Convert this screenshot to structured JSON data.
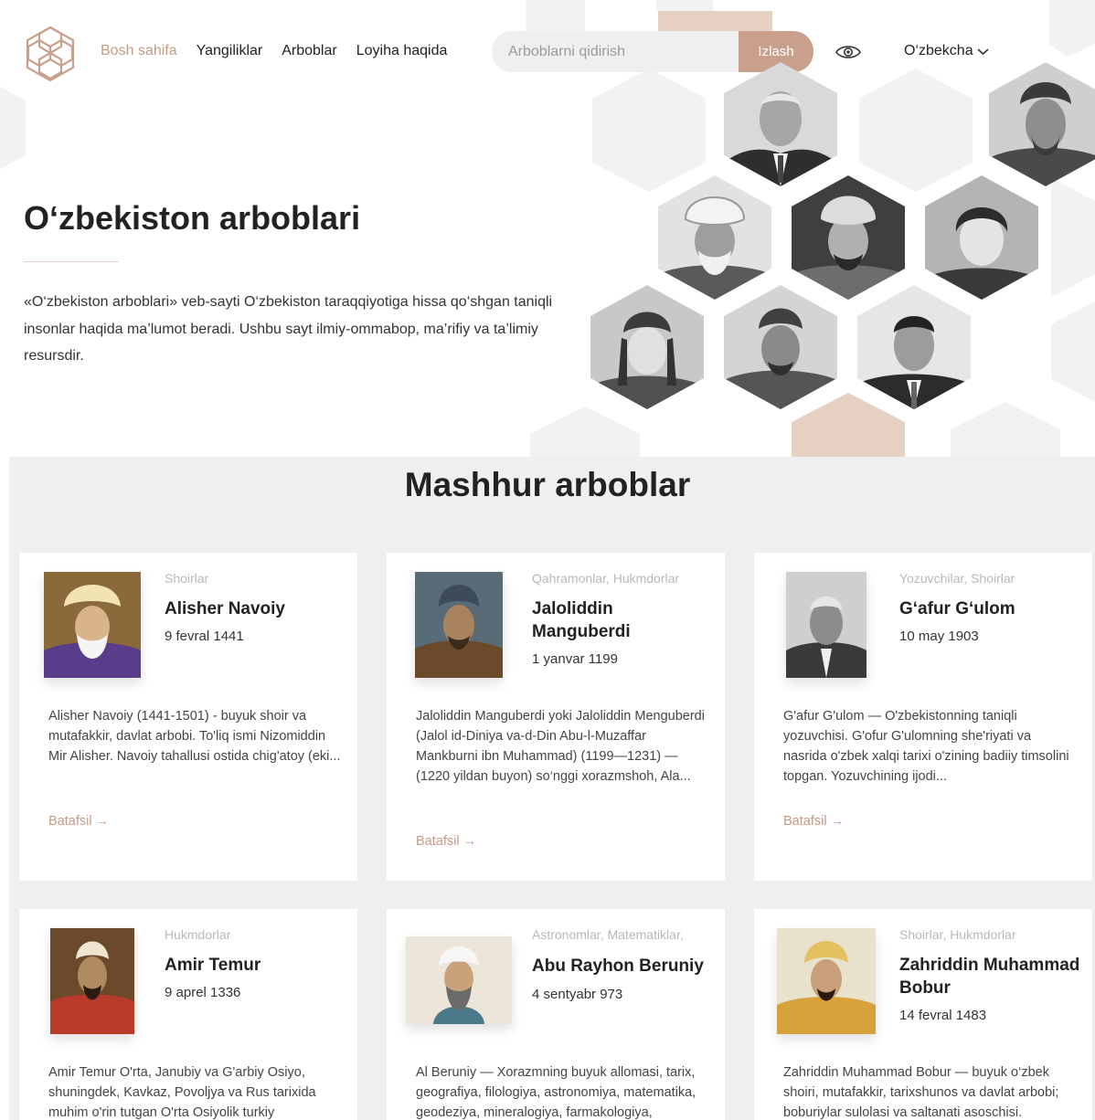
{
  "nav": {
    "items": [
      "Bosh sahifa",
      "Yangiliklar",
      "Arboblar",
      "Loyiha haqida"
    ],
    "active": "Bosh sahifa"
  },
  "search": {
    "placeholder": "Arboblarni qidirish",
    "button_label": "Izlash"
  },
  "accessibility": {
    "icon": "eye-icon"
  },
  "language": {
    "selected": "O‘zbekcha",
    "icon": "chevron-down-icon"
  },
  "hero": {
    "title": "O‘zbekiston arboblari",
    "description": "«O‘zbekiston arboblari» veb-sayti O‘zbekiston taraqqiyotiga hissa  qo‘shgan taniqli insonlar haqida ma’lumot beradi. Ushbu sayt ilmiy-ommabop, ma’rifiy va ta’limiy resursdir."
  },
  "famous": {
    "title": "Mashhur arboblar",
    "more_label": "Batafsil →",
    "cards": [
      {
        "category": "Shoirlar",
        "name": "Alisher Navoiy",
        "date": "9 fevral 1441",
        "description": "Alisher Navoiy (1441-1501) - buyuk shoir va mutafakkir, davlat arbobi. To'liq ismi Nizomiddin Mir Alisher. Navoiy tahallusi ostida chig'atoy (eki..."
      },
      {
        "category": "Qahramonlar, Hukmdorlar",
        "name": "Jaloliddin Manguberdi",
        "date": "1 yanvar 1199",
        "description": "Jaloliddin Manguberdi yoki Jaloliddin Menguberdi (Jalol id-Diniya va-d-Din Abu-l-Muzaffar Mankburni ibn Muhammad) (1199—1231) — (1220 yildan buyon) so‘nggi xorazmshoh, Ala..."
      },
      {
        "category": "Yozuvchilar, Shoirlar",
        "name": "G‘afur G‘ulom",
        "date": "10 may 1903",
        "description": "G'afur G'ulom — O'zbekistonning taniqli yozuvchisi. G'ofur G'ulomning she'riyati va nasrida o'zbek xalqi tarixi o'zining badiiy timsolini topgan. Yozuvchining ijodi..."
      },
      {
        "category": "Hukmdorlar",
        "name": "Amir Temur",
        "date": "9 aprel 1336",
        "description": "Amir Temur O'rta, Janubiy va G'arbiy Osiyo, shuningdek, Kavkaz, Povoljya va Rus tarixida muhim o'rin tutgan O'rta Osiyolik turkiy"
      },
      {
        "category": "Astronomlar, Matematiklar,",
        "name": "Abu Rayhon Beruniy",
        "date": "4 sentyabr 973",
        "description": "Al Beruniy — Xorazmning buyuk allomasi, tarix, geografiya, filologiya, astronomiya, matematika, geodeziya, mineralogiya, farmakologiya,"
      },
      {
        "category": "Shoirlar, Hukmdorlar",
        "name": "Zahriddin Muhammad Bobur",
        "date": "14 fevral 1483",
        "description": "Zahriddin Muhammad Bobur — buyuk o‘zbek shoiri, mutafakkir, tarixshunos va davlat arbobi; boburiylar sulolasi va saltanati asoschisi."
      }
    ]
  },
  "colors": {
    "accent": "#c9a08c",
    "accent_text": "#c79a84",
    "section_bg": "#efefef",
    "hex_light": "#f1f1f1",
    "hex_tan": "#e3cdc1"
  }
}
